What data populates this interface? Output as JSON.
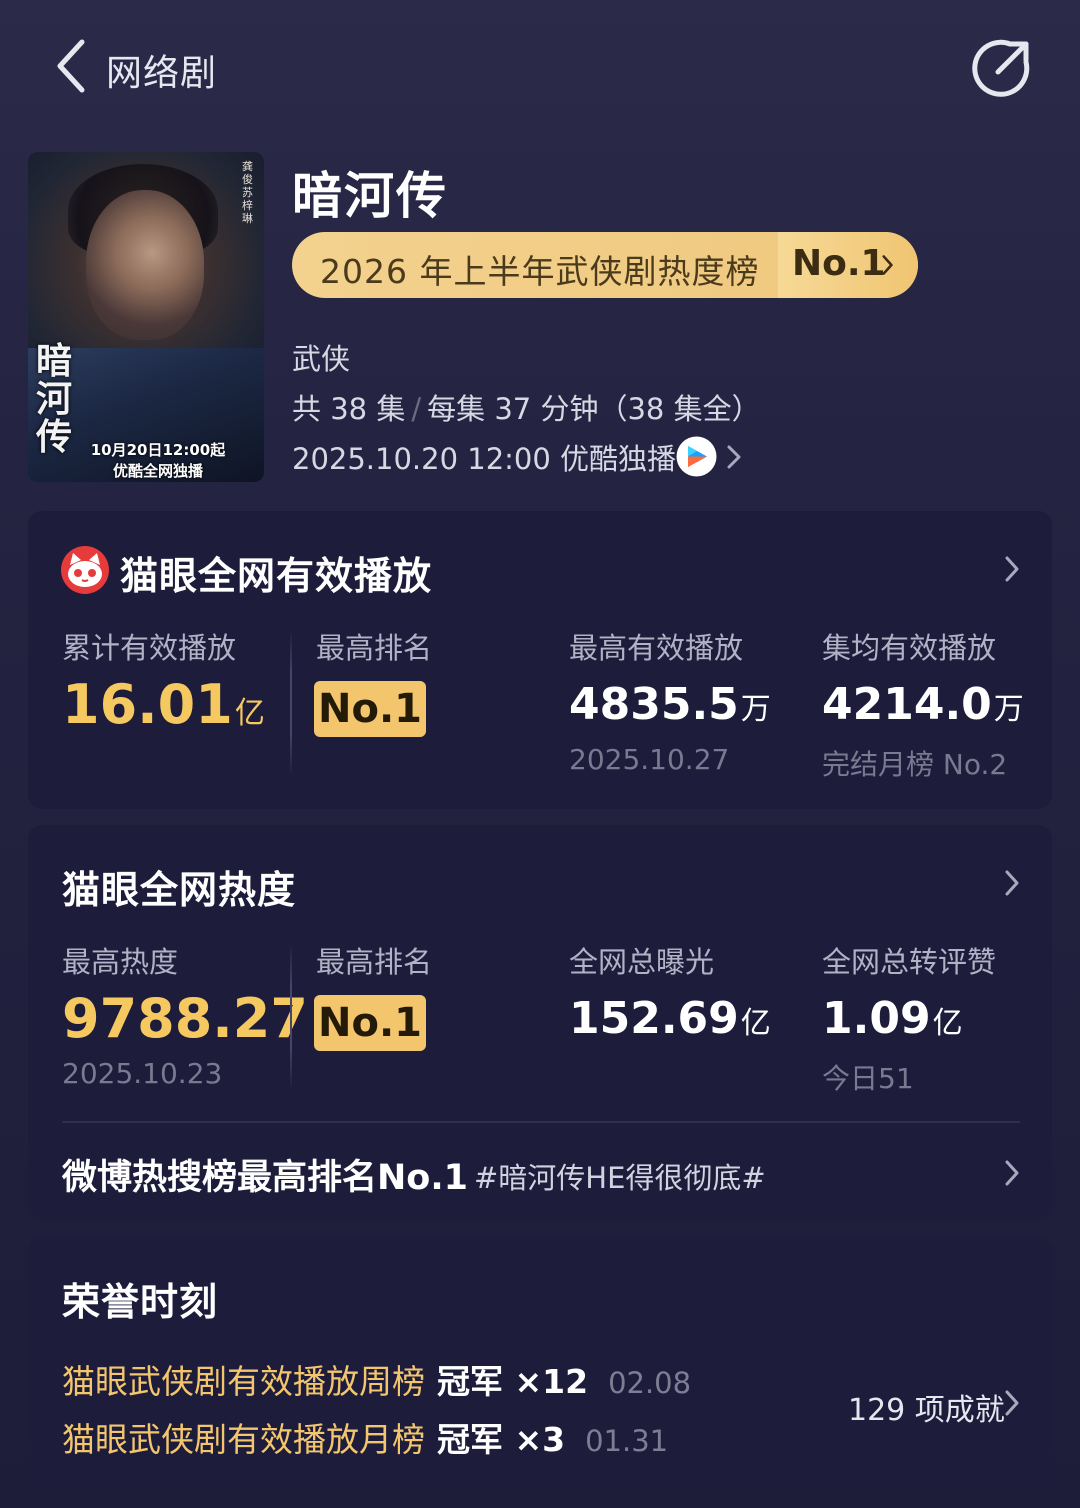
{
  "header": {
    "title": "网络剧",
    "back_icon": "chevron-left-icon",
    "share_icon": "share-icon"
  },
  "poster": {
    "calligraphy": "暗河传",
    "caption_line1": "10月20日12:00起",
    "caption_line2": "优酷全网独播",
    "side_text": "龚俊 苏梓琳"
  },
  "show": {
    "title": "暗河传",
    "rank_banner_text": "2026 年上半年武侠剧热度榜",
    "rank_banner_no": "No.1",
    "genre": "武侠",
    "episodes_total": "共 38 集",
    "episodes_detail": "每集 37 分钟（38 集全）",
    "airdate": "2025.10.20 12:00 优酷独播",
    "platform_icon": "youku-icon"
  },
  "play_card": {
    "title": "猫眼全网有效播放",
    "logo_icon": "maoyan-cat-icon",
    "cumulative_label": "累计有效播放",
    "cumulative_value": "16.01",
    "cumulative_unit": "亿",
    "rank_label": "最高排名",
    "rank_value": "No.1",
    "peak_label": "最高有效播放",
    "peak_value": "4835.5",
    "peak_unit": "万",
    "peak_date": "2025.10.27",
    "avg_label": "集均有效播放",
    "avg_value": "4214.0",
    "avg_unit": "万",
    "avg_sub": "完结月榜 No.2"
  },
  "heat_card": {
    "title": "猫眼全网热度",
    "peak_heat_label": "最高热度",
    "peak_heat_value": "9788.27",
    "peak_heat_date": "2025.10.23",
    "rank_label": "最高排名",
    "rank_value": "No.1",
    "exposure_label": "全网总曝光",
    "exposure_value": "152.69",
    "exposure_unit": "亿",
    "engage_label": "全网总转评赞",
    "engage_value": "1.09",
    "engage_unit": "亿",
    "engage_sub": "今日51",
    "weibo_text": "微博热搜榜最高排名No.1",
    "weibo_tag": "#暗河传HE得很彻底#"
  },
  "honor_card": {
    "title": "荣誉时刻",
    "items": [
      {
        "label": "猫眼武侠剧有效播放周榜",
        "count": "冠军 ×12",
        "date": "02.08"
      },
      {
        "label": "猫眼武侠剧有效播放月榜",
        "count": "冠军 ×3",
        "date": "01.31"
      }
    ],
    "achievements": "129 项成就"
  },
  "colors": {
    "background": "#242442",
    "card": "#1d1c3b",
    "gold": "#f5c860",
    "badge": "#f3c66d"
  }
}
